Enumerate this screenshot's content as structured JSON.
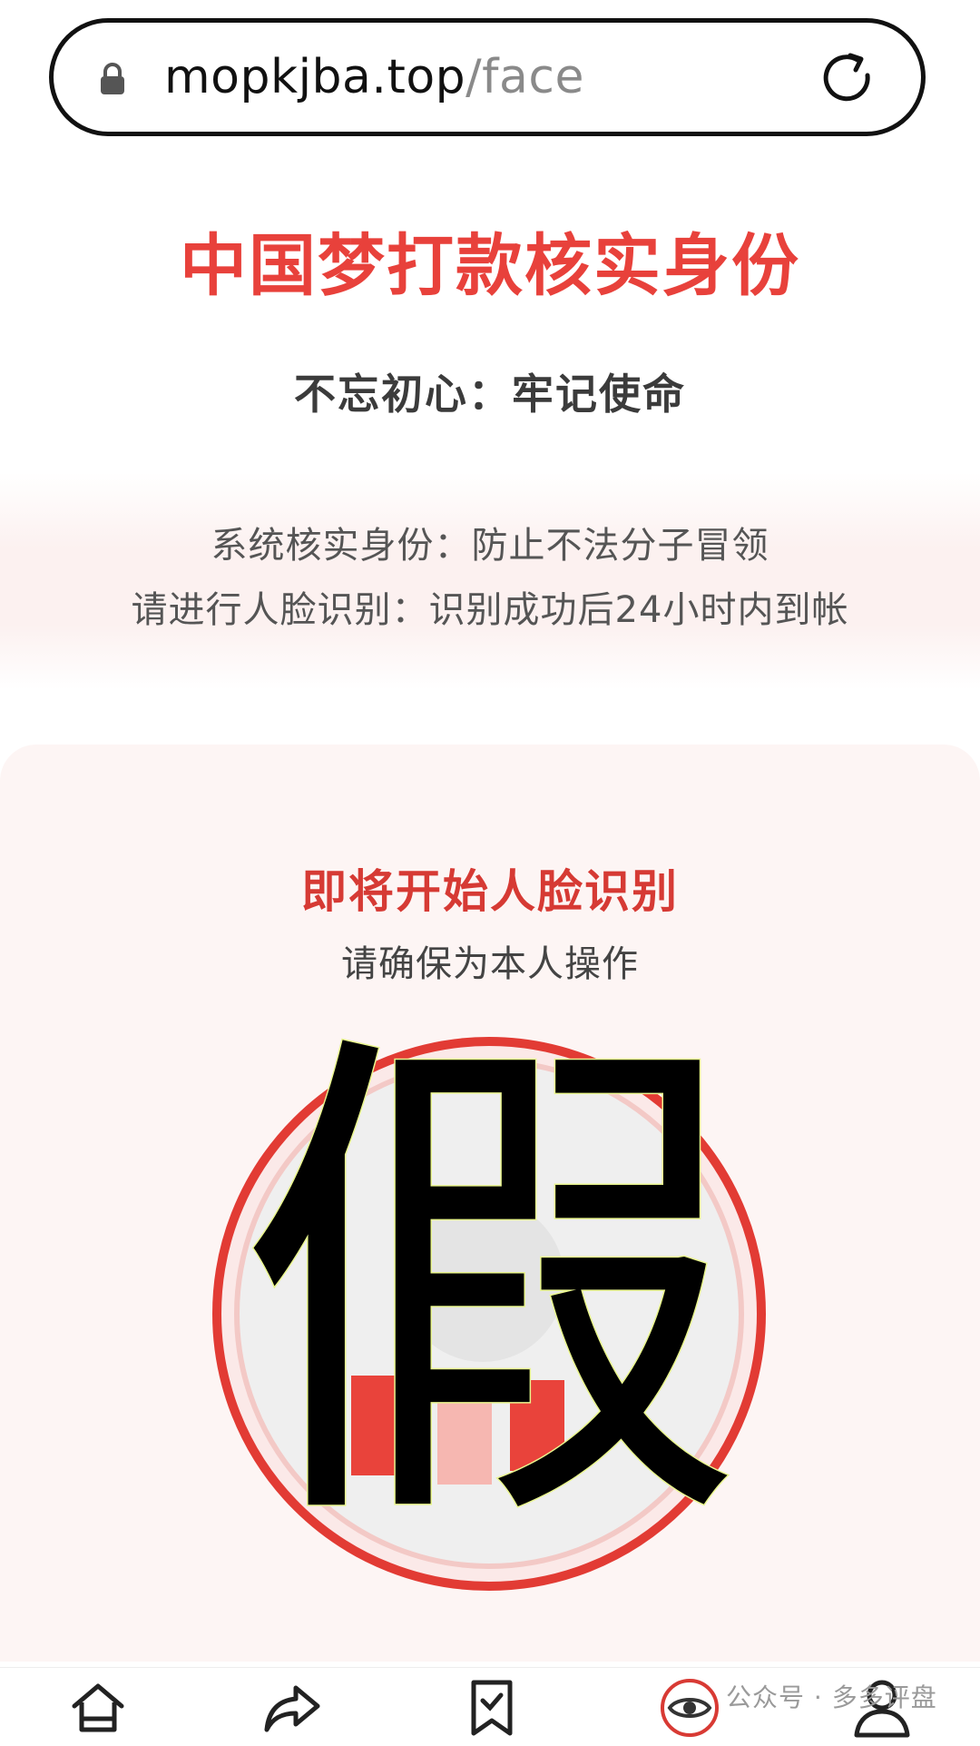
{
  "browser": {
    "url_host": "mopkjba.top",
    "url_path": "/face",
    "icons": {
      "lock": "lock-icon",
      "reload": "reload-icon"
    }
  },
  "header": {
    "title": "中国梦打款核实身份",
    "slogan": "不忘初心：牢记使命"
  },
  "notice": {
    "line1": "系统核实身份：防止不法分子冒领",
    "line2": "请进行人脸识别：识别成功后24小时内到帐"
  },
  "face_check": {
    "title": "即将开始人脸识别",
    "subtitle": "请确保为本人操作",
    "overlay_char": "假"
  },
  "bottom_nav": {
    "items": [
      "home-icon",
      "share-icon",
      "bookmark-icon",
      "eye-icon",
      "profile-icon"
    ]
  },
  "watermark": {
    "text": "公众号 · 多多评盘"
  },
  "colors": {
    "title_red": "#e8413b",
    "ring_red": "#e23b34",
    "band_pink": "#fcf1f0"
  }
}
